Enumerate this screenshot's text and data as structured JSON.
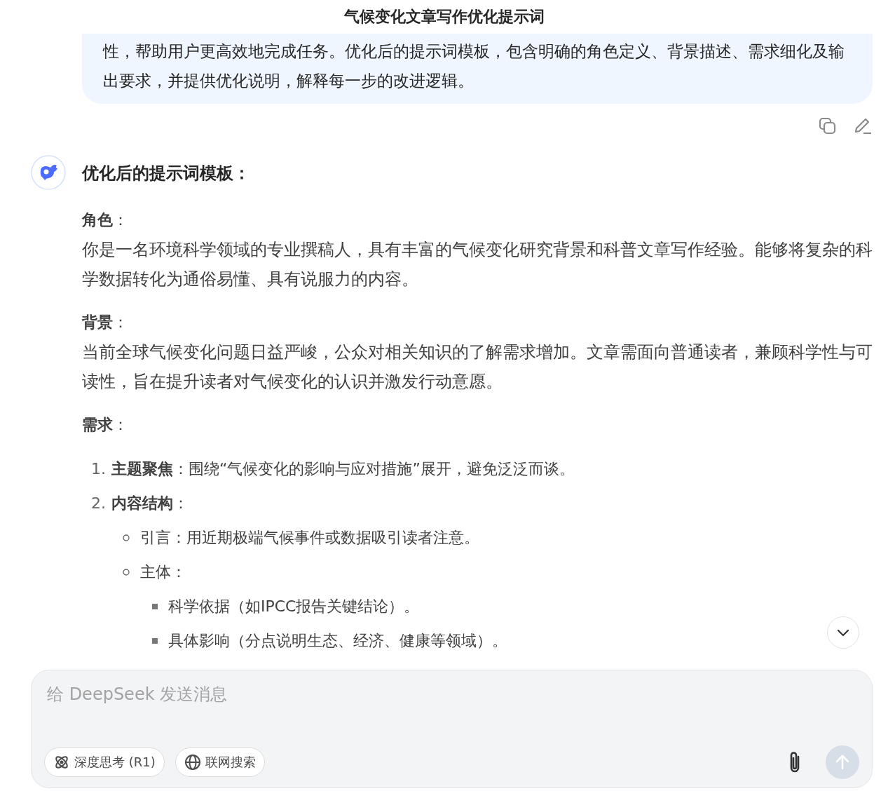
{
  "title": "气候变化文章写作优化提示词",
  "user_message": {
    "text": "性，帮助用户更高效地完成任务。优化后的提示词模板，包含明确的角色定义、背景描述、需求细化及输出要求，并提供优化说明，解释每一步的改进逻辑。"
  },
  "assistant": {
    "heading": "优化后的提示词模板：",
    "sections": [
      {
        "label": "**角色**：",
        "text": "你是一名环境科学领域的专业撰稿人，具有丰富的气候变化研究背景和科普文章写作经验。能够将复杂的科学数据转化为通俗易懂、具有说服力的内容。"
      },
      {
        "label": "**背景**：",
        "text": "当前全球气候变化问题日益严峻，公众对相关知识的了解需求增加。文章需面向普通读者，兼顾科学性与可读性，旨在提升读者对气候变化的认识并激发行动意愿。"
      },
      {
        "label": "**需求**：",
        "list": [
          {
            "number": "1.",
            "text": "**主题聚焦**：围绕“气候变化的影响与应对措施”展开，避免泛泛而谈。"
          },
          {
            "number": "2.",
            "text": "**内容结构**：",
            "children": [
              {
                "text": "引言：用近期极端气候事件或数据吸引读者注意。"
              },
              {
                "text": "主体：",
                "children": [
                  {
                    "text": "科学依据（如IPCC报告关键结论）。"
                  },
                  {
                    "text": "具体影响（分点说明生态、经济、健康等领域）。"
                  }
                ]
              }
            ]
          }
        ]
      }
    ]
  },
  "composer": {
    "placeholder": "给 DeepSeek 发送消息",
    "toggles": [
      {
        "kind": "think",
        "label": "深度思考 (R1)",
        "selected": false
      },
      {
        "kind": "search",
        "label": "联网搜索",
        "selected": false
      }
    ]
  }
}
